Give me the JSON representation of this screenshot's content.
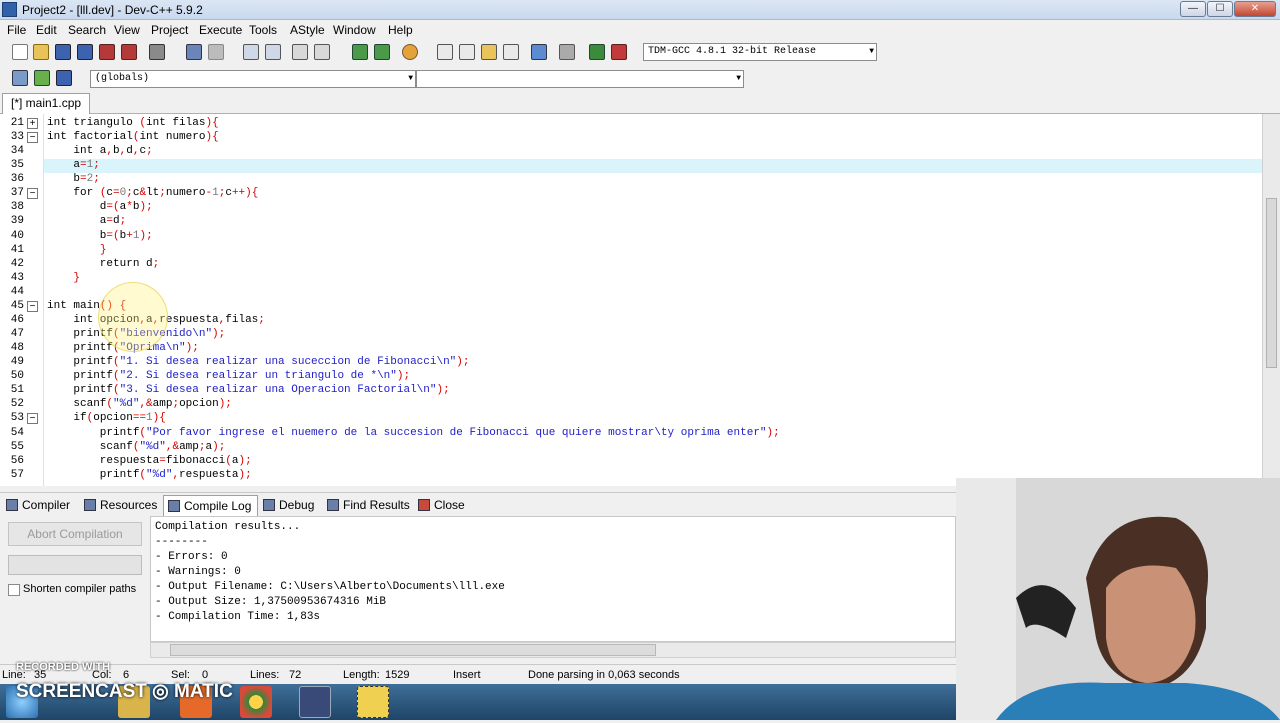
{
  "window": {
    "title": "Project2 - [lll.dev] - Dev-C++ 5.9.2",
    "controls": [
      "—",
      "☐",
      "✕"
    ]
  },
  "menu": [
    "File",
    "Edit",
    "Search",
    "View",
    "Project",
    "Execute",
    "Tools",
    "AStyle",
    "Window",
    "Help"
  ],
  "toolbar": {
    "compiler_combo": "TDM-GCC 4.8.1 32-bit Release",
    "globals_combo": "(globals)",
    "members_combo": ""
  },
  "file_tab": "[*] main1.cpp",
  "editor": {
    "lines": [
      {
        "n": "21",
        "fold": "+",
        "code": "int triangulo (int filas){"
      },
      {
        "n": "33",
        "fold": "−",
        "code": "int factorial(int numero){"
      },
      {
        "n": "34",
        "fold": "",
        "code": "    int a,b,d,c;"
      },
      {
        "n": "35",
        "fold": "",
        "code": "    a=1;"
      },
      {
        "n": "36",
        "fold": "",
        "code": "    b=2;"
      },
      {
        "n": "37",
        "fold": "−",
        "code": "    for (c=0;c<numero-1;c++){"
      },
      {
        "n": "38",
        "fold": "",
        "code": "        d=(a*b);"
      },
      {
        "n": "39",
        "fold": "",
        "code": "        a=d;"
      },
      {
        "n": "40",
        "fold": "",
        "code": "        b=(b+1);"
      },
      {
        "n": "41",
        "fold": "",
        "code": "        }"
      },
      {
        "n": "42",
        "fold": "",
        "code": "        return d;"
      },
      {
        "n": "43",
        "fold": "",
        "code": "    }"
      },
      {
        "n": "44",
        "fold": "",
        "code": ""
      },
      {
        "n": "45",
        "fold": "−",
        "code": "int main() {"
      },
      {
        "n": "46",
        "fold": "",
        "code": "    int opcion,a,respuesta,filas;"
      },
      {
        "n": "47",
        "fold": "",
        "code": "    printf(\"bienvenido\\n\");"
      },
      {
        "n": "48",
        "fold": "",
        "code": "    printf(\"Oprima\\n\");"
      },
      {
        "n": "49",
        "fold": "",
        "code": "    printf(\"1. Si desea realizar una suceccion de Fibonacci\\n\");"
      },
      {
        "n": "50",
        "fold": "",
        "code": "    printf(\"2. Si desea realizar un triangulo de *\\n\");"
      },
      {
        "n": "51",
        "fold": "",
        "code": "    printf(\"3. Si desea realizar una Operacion Factorial\\n\");"
      },
      {
        "n": "52",
        "fold": "",
        "code": "    scanf(\"%d\",&opcion);"
      },
      {
        "n": "53",
        "fold": "−",
        "code": "    if(opcion==1){"
      },
      {
        "n": "54",
        "fold": "",
        "code": "        printf(\"Por favor ingrese el nuemero de la succesion de Fibonacci que quiere mostrar\\ty oprima enter\");"
      },
      {
        "n": "55",
        "fold": "",
        "code": "        scanf(\"%d\",&a);"
      },
      {
        "n": "56",
        "fold": "",
        "code": "        respuesta=fibonacci(a);"
      },
      {
        "n": "57",
        "fold": "",
        "code": "        printf(\"%d\",respuesta);"
      }
    ]
  },
  "bottom_tabs": [
    "Compiler",
    "Resources",
    "Compile Log",
    "Debug",
    "Find Results",
    "Close"
  ],
  "compile_panel": {
    "abort_label": "Abort Compilation",
    "shorten_label": "Shorten compiler paths"
  },
  "compile_log": [
    "Compilation results...",
    "--------",
    "- Errors: 0",
    "- Warnings: 0",
    "- Output Filename: C:\\Users\\Alberto\\Documents\\lll.exe",
    "- Output Size: 1,37500953674316 MiB",
    "- Compilation Time: 1,83s"
  ],
  "status": {
    "line_label": "Line:",
    "line": "35",
    "col_label": "Col:",
    "col": "6",
    "sel_label": "Sel:",
    "sel": "0",
    "lines_label": "Lines:",
    "lines": "72",
    "length_label": "Length:",
    "length": "1529",
    "mode": "Insert",
    "message": "Done parsing in 0,063 seconds"
  },
  "watermark": {
    "small": "RECORDED WITH",
    "big": "SCREENCAST ◎ MATIC"
  },
  "colors": {
    "current_line": "#d9f4fb",
    "string": "#1d1dc7",
    "symbol": "#d40000"
  }
}
